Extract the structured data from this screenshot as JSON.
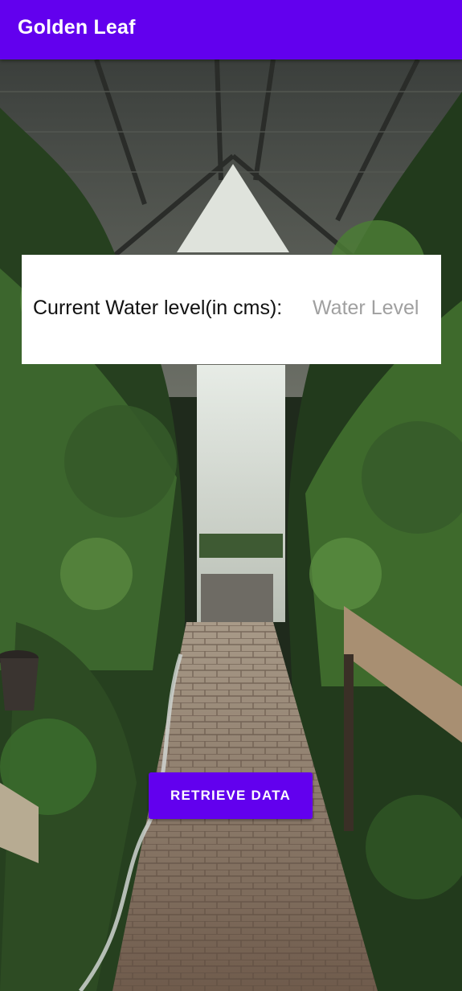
{
  "app_bar": {
    "title": "Golden Leaf",
    "color": "#6200ee"
  },
  "background": {
    "description": "greenhouse-photo"
  },
  "water_level": {
    "label": "Current Water level(in cms):",
    "value": "",
    "placeholder": "Water Level"
  },
  "actions": {
    "retrieve_label": "RETRIEVE DATA"
  }
}
